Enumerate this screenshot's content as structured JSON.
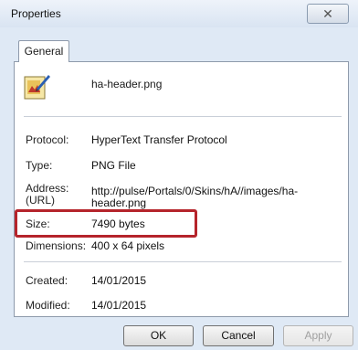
{
  "window": {
    "title": "Properties",
    "close_glyph": "✕"
  },
  "tab": {
    "label": "General"
  },
  "file": {
    "name": "ha-header.png",
    "icon": "image-file-icon"
  },
  "fields": {
    "protocol": {
      "label": "Protocol:",
      "value": "HyperText Transfer Protocol"
    },
    "type": {
      "label": "Type:",
      "value": "PNG File"
    },
    "address": {
      "label_line1": "Address:",
      "label_line2": "(URL)",
      "value_line1": "http://pulse/Portals/0/Skins/hA//images/ha-",
      "value_line2": "header.png"
    },
    "size": {
      "label": "Size:",
      "value": "7490 bytes"
    },
    "dimensions": {
      "label": "Dimensions:",
      "value": "400 x 64 pixels"
    },
    "created": {
      "label": "Created:",
      "value": "14/01/2015"
    },
    "modified": {
      "label": "Modified:",
      "value": "14/01/2015"
    }
  },
  "buttons": {
    "ok": "OK",
    "cancel": "Cancel",
    "apply": "Apply"
  },
  "colors": {
    "highlight": "#b5242b",
    "window_bg": "#dfe9f5"
  }
}
